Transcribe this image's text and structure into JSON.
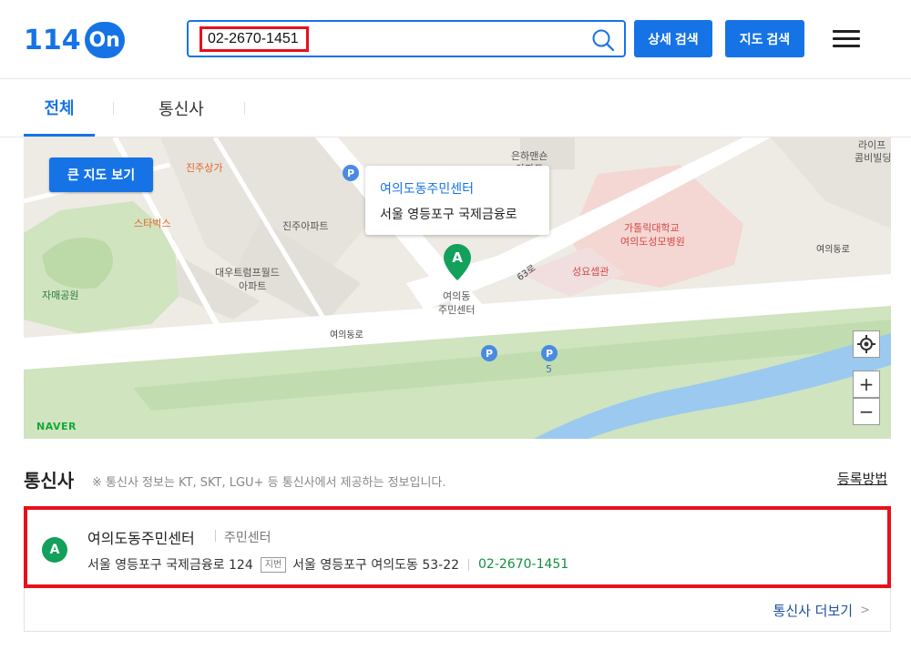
{
  "header": {
    "logo_number": "114",
    "logo_badge": "On",
    "search_value": "02-2670-1451",
    "search_icon": "search-icon",
    "detail_search_label": "상세 검색",
    "map_search_label": "지도 검색",
    "menu_icon": "hamburger-menu-icon"
  },
  "tabs": [
    {
      "label": "전체",
      "active": true
    },
    {
      "label": "통신사",
      "active": false
    }
  ],
  "map": {
    "big_map_button": "큰 지도 보기",
    "popup_name": "여의도동주민센터",
    "popup_address": "서울 영등포구 국제금융로",
    "marker_letter": "A",
    "provider_logo": "NAVER",
    "labels": {
      "jinju_market": "진주상가",
      "starbucks": "스타벅스",
      "jinju_apt": "진주아파트",
      "daewoo_apt_1": "대우트럼프월드",
      "daewoo_apt_2": "아파트",
      "jamae_park": "자매공원",
      "center_1": "여의동",
      "center_2": "주민센터",
      "eunha_1": "은하맨숀",
      "eunha_2": "아파트",
      "catholic_1": "가톨릭대학교",
      "catholic_2": "여의도성모병원",
      "seongyo": "성요셉관",
      "life_1": "라이프",
      "life_2": "콤비빌딩",
      "yeouidong_ro_1": "여의동로",
      "yeouidong_ro_2": "여의동로",
      "road_63": "63로",
      "parking_num": "5"
    },
    "controls": {
      "locate_icon": "current-location-icon",
      "zoom_in": "+",
      "zoom_out": "−"
    }
  },
  "section": {
    "title": "통신사",
    "note": "※ 통신사 정보는 KT, SKT, LGU+ 등 통신사에서 제공하는 정보입니다.",
    "register_link": "등록방법"
  },
  "result": {
    "badge": "A",
    "name": "여의도동주민센터",
    "category": "주민센터",
    "road_address": "서울 영등포구 국제금융로 124",
    "jibun_tag": "지번",
    "jibun_address": "서울 영등포구 여의도동 53-22",
    "phone": "02-2670-1451"
  },
  "more": {
    "label": "통신사 더보기",
    "arrow": ">"
  },
  "colors": {
    "brand_blue": "#1673e6",
    "highlight_red": "#e8101c",
    "badge_green": "#12a05a",
    "phone_green": "#12903e"
  }
}
